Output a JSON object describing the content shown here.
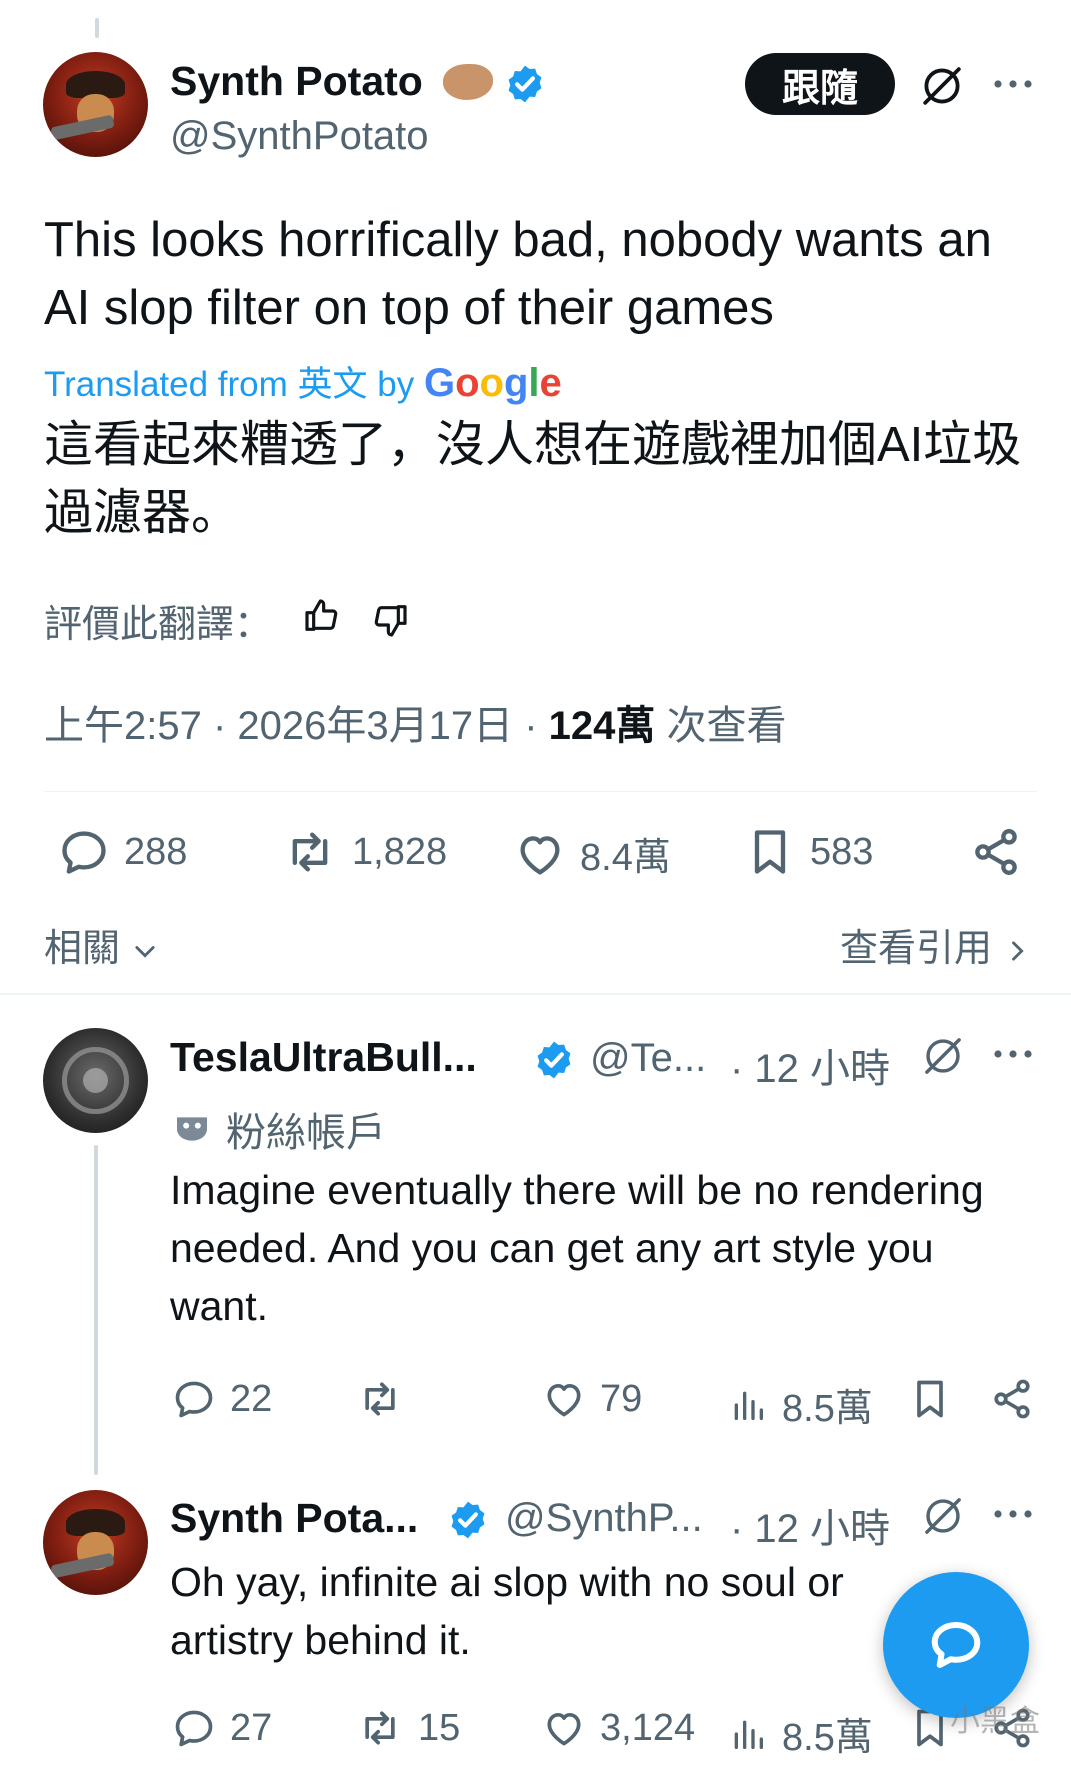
{
  "main_tweet": {
    "display_name": "Synth Potato",
    "handle": "@SynthPotato",
    "follow_label": "跟隨",
    "text": "This looks horrifically bad, nobody wants an AI slop filter on top of their games",
    "translated_prefix": "Translated from 英文 by",
    "translated_brand": "Google",
    "translation": "這看起來糟透了，沒人想在遊戲裡加個AI垃圾過濾器。",
    "rate_label": "評價此翻譯：",
    "timestamp": "上午2:57 · 2026年3月17日 · ",
    "views_count": "124萬",
    "views_label": " 次查看",
    "replies": "288",
    "reposts": "1,828",
    "likes": "8.4萬",
    "bookmarks": "583",
    "related_label": "相關",
    "quotes_label": "查看引用"
  },
  "replies": [
    {
      "display_name": "TeslaUltraBull...",
      "handle": "@Te...",
      "time": "· 12 小時",
      "badge_label": "粉絲帳戶",
      "text": "Imagine eventually there will be no rendering needed. And you can get any art style you want.",
      "replies": "22",
      "reposts": "",
      "likes": "79",
      "views": "8.5萬"
    },
    {
      "display_name": "Synth Pota...",
      "handle": "@SynthP...",
      "time": "· 12 小時",
      "text": "Oh yay, infinite ai slop with no soul or artistry behind it.",
      "replies": "27",
      "reposts": "15",
      "likes": "3,124",
      "views": "8.5萬"
    }
  ],
  "watermark": "小黑盒",
  "colors": {
    "accent": "#1d9bf0",
    "text": "#0f1419",
    "muted": "#536471"
  }
}
